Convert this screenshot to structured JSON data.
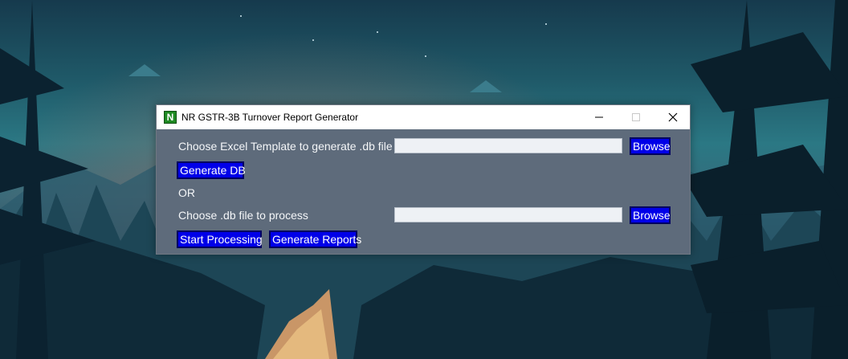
{
  "window": {
    "title": "NR GSTR-3B Turnover Report Generator",
    "icon_letter": "N",
    "icon_name": "app-icon",
    "controls": [
      "minimize-icon",
      "maximize-icon",
      "close-icon"
    ]
  },
  "form": {
    "template_label": "Choose Excel Template to generate .db file",
    "template_value": "",
    "browse_label": "Browse",
    "generate_db_label": "Generate DB",
    "or_label": "OR",
    "db_label": "Choose .db file to process",
    "db_value": "",
    "browse2_label": "Browse",
    "start_label": "Start Processing",
    "reports_label": "Generate Reports"
  },
  "colors": {
    "window_body": "#5e6b7b",
    "button_bg": "#0000e8",
    "button_text": "#ffffff",
    "label_text": "#f4f6f8"
  }
}
